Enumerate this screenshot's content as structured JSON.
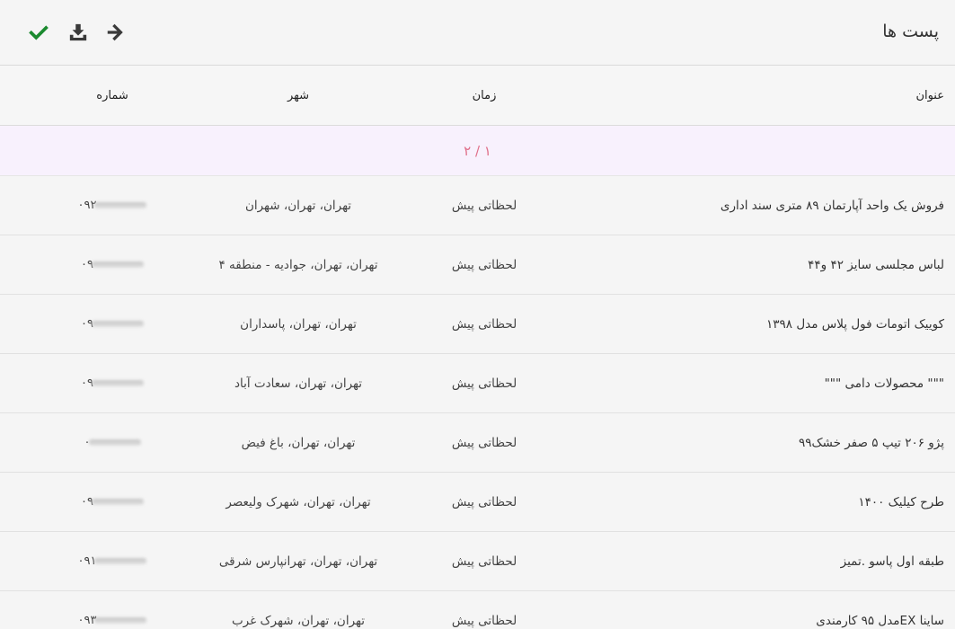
{
  "header": {
    "title": "پست ها"
  },
  "toolbar": {
    "confirm_icon": "check-icon",
    "download_icon": "download-icon",
    "forward_icon": "arrow-right-icon"
  },
  "colors": {
    "confirm_green": "#1b8a2f",
    "pagination_text": "#e0708a",
    "pagination_background": "#f8f1fd"
  },
  "table": {
    "columns": {
      "title": "عنوان",
      "time": "زمان",
      "city": "شهر",
      "phone": "شماره"
    },
    "pagination": "۱ / ۲",
    "rows": [
      {
        "title": "فروش یک واحد آپارتمان ۸۹ متری سند اداری",
        "time": "لحظاتی پیش",
        "city": "تهران، تهران، شهران",
        "phone": "۰۹۲"
      },
      {
        "title": "لباس مجلسی سایز ۴۲ و۴۴",
        "time": "لحظاتی پیش",
        "city": "تهران، تهران، جوادیه - منطقه ۴",
        "phone": "۰۹"
      },
      {
        "title": "کوییک اتومات فول پلاس مدل ۱۳۹۸",
        "time": "لحظاتی پیش",
        "city": "تهران، تهران، پاسداران",
        "phone": "۰۹"
      },
      {
        "title": "\"\"\" محصولات دامی \"\"\"",
        "time": "لحظاتی پیش",
        "city": "تهران، تهران، سعادت آباد",
        "phone": "۰۹"
      },
      {
        "title": "پژو ۲۰۶ تیپ ۵ صفر خشک۹۹",
        "time": "لحظاتی پیش",
        "city": "تهران، تهران، باغ فیض",
        "phone": "۰"
      },
      {
        "title": "طرح کیلیک ۱۴۰۰",
        "time": "لحظاتی پیش",
        "city": "تهران، تهران، شهرک ولیعصر",
        "phone": "۰۹"
      },
      {
        "title": "طبقه اول پاسو .تمیز",
        "time": "لحظاتی پیش",
        "city": "تهران، تهران، تهرانپارس شرقی",
        "phone": "۰۹۱"
      },
      {
        "title": "ساینا EXمدل ۹۵ کارمندی",
        "time": "لحظاتی پیش",
        "city": "تهران، تهران، شهرک غرب",
        "phone": "۰۹۳"
      }
    ]
  }
}
